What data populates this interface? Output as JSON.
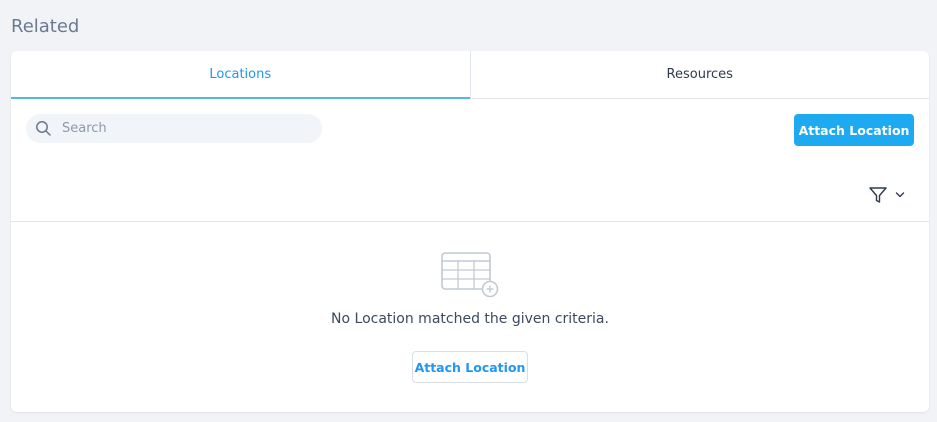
{
  "section": {
    "title": "Related"
  },
  "tabs": [
    {
      "label": "Locations",
      "active": true
    },
    {
      "label": "Resources",
      "active": false
    }
  ],
  "toolbar": {
    "search_placeholder": "Search",
    "search_value": "",
    "search_icon": "search-icon",
    "attach_label": "Attach Location",
    "filter_icon": "filter-icon",
    "filter_chevron_icon": "chevron-down-icon"
  },
  "empty_state": {
    "icon": "table-add-icon",
    "message": "No Location matched the given criteria.",
    "attach_label": "Attach Location"
  },
  "colors": {
    "accent": "#1eaaf1",
    "active_tab_text": "#2196f3",
    "active_tab_underline": "#55b6ea",
    "background": "#f1f3f7",
    "card": "#ffffff"
  }
}
